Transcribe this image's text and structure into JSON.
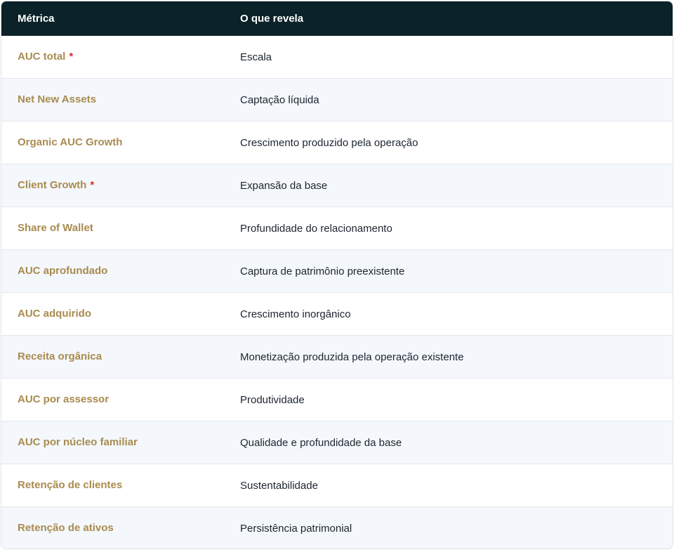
{
  "table": {
    "headers": [
      "Métrica",
      "O que revela"
    ],
    "rows": [
      {
        "metric": "AUC total",
        "marker": "*",
        "reveals": "Escala"
      },
      {
        "metric": "Net New Assets",
        "marker": "",
        "reveals": "Captação líquida"
      },
      {
        "metric": "Organic AUC Growth",
        "marker": "",
        "reveals": "Crescimento produzido pela operação"
      },
      {
        "metric": "Client Growth",
        "marker": "*",
        "reveals": "Expansão da base"
      },
      {
        "metric": "Share of Wallet",
        "marker": "",
        "reveals": "Profundidade do relacionamento"
      },
      {
        "metric": "AUC aprofundado",
        "marker": "",
        "reveals": "Captura de patrimônio preexistente"
      },
      {
        "metric": "AUC adquirido",
        "marker": "",
        "reveals": "Crescimento inorgânico"
      },
      {
        "metric": "Receita orgânica",
        "marker": "",
        "reveals": "Monetização produzida pela operação existente"
      },
      {
        "metric": "AUC por assessor",
        "marker": "",
        "reveals": "Produtividade"
      },
      {
        "metric": "AUC por núcleo familiar",
        "marker": "",
        "reveals": "Qualidade e profundidade da base"
      },
      {
        "metric": "Retenção de clientes",
        "marker": "",
        "reveals": "Sustentabilidade"
      },
      {
        "metric": "Retenção de ativos",
        "marker": "",
        "reveals": "Persistência patrimonial"
      }
    ]
  },
  "colors": {
    "header_bg": "#0a2228",
    "metric_text": "#a98b4f",
    "marker": "#d0342c",
    "alt_row_bg": "#f4f7fb"
  }
}
